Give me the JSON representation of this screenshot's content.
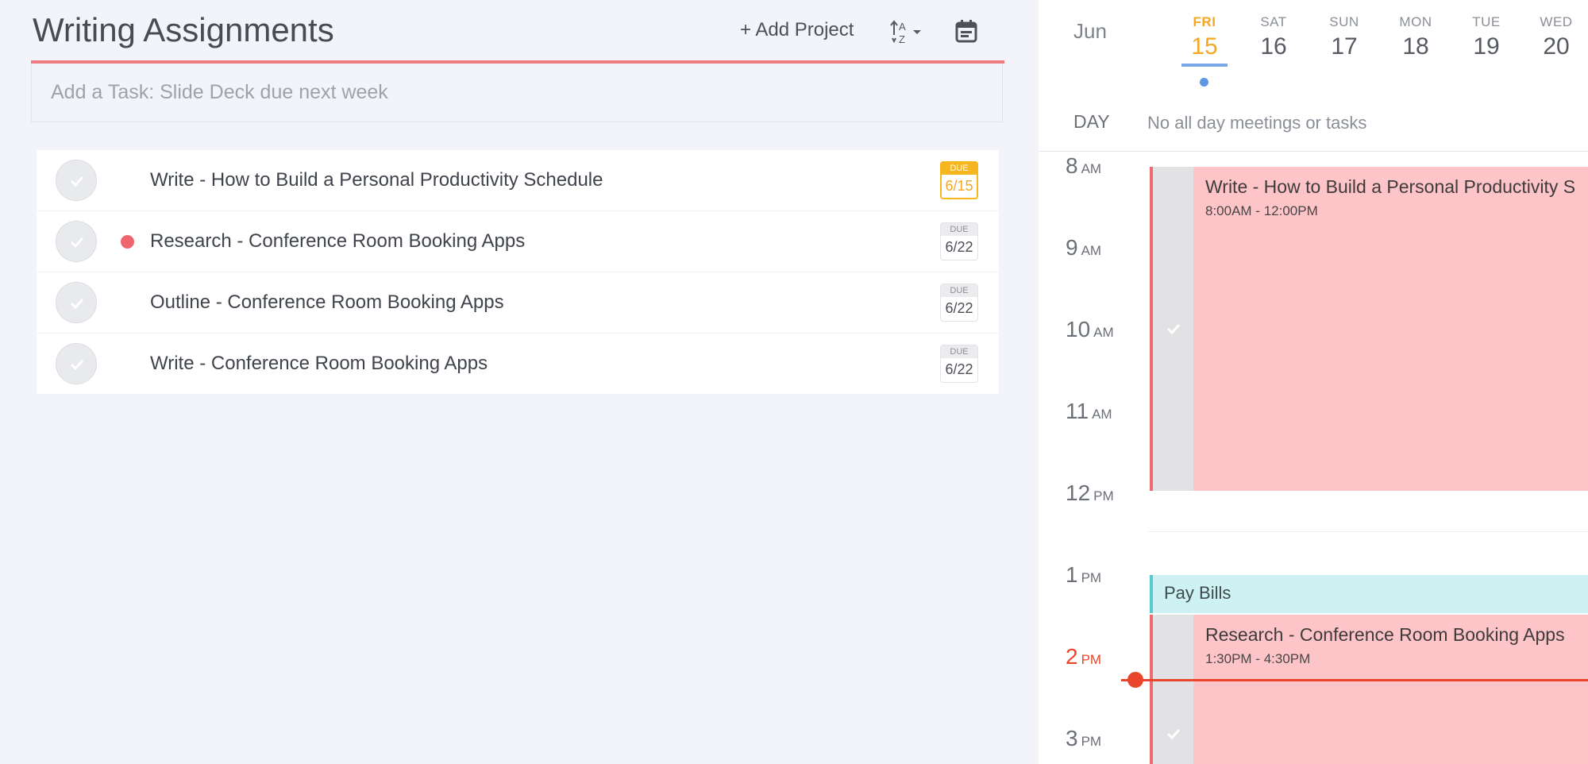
{
  "project": {
    "title": "Writing Assignments",
    "add_project_label": "+ Add Project",
    "sort_label": "A Z",
    "add_task_placeholder": "Add a Task: Slide Deck due next week"
  },
  "tasks": [
    {
      "title": "Write - How to Build a Personal Productivity Schedule",
      "due_label": "DUE",
      "due_date": "6/15",
      "priority": false,
      "today": true
    },
    {
      "title": "Research - Conference Room Booking Apps",
      "due_label": "DUE",
      "due_date": "6/22",
      "priority": true,
      "today": false
    },
    {
      "title": "Outline - Conference Room Booking Apps",
      "due_label": "DUE",
      "due_date": "6/22",
      "priority": false,
      "today": false
    },
    {
      "title": "Write - Conference Room Booking Apps",
      "due_label": "DUE",
      "due_date": "6/22",
      "priority": false,
      "today": false
    }
  ],
  "calendar": {
    "month": "Jun",
    "days": [
      {
        "name": "FRI",
        "num": "15",
        "active": true
      },
      {
        "name": "SAT",
        "num": "16",
        "active": false
      },
      {
        "name": "SUN",
        "num": "17",
        "active": false
      },
      {
        "name": "MON",
        "num": "18",
        "active": false
      },
      {
        "name": "TUE",
        "num": "19",
        "active": false
      },
      {
        "name": "WED",
        "num": "20",
        "active": false
      }
    ],
    "allday_label": "DAY",
    "allday_text": "No all day meetings or tasks",
    "hours": [
      {
        "num": "8",
        "ampm": "AM"
      },
      {
        "num": "9",
        "ampm": "AM"
      },
      {
        "num": "10",
        "ampm": "AM"
      },
      {
        "num": "11",
        "ampm": "AM"
      },
      {
        "num": "12",
        "ampm": "PM"
      },
      {
        "num": "1",
        "ampm": "PM"
      },
      {
        "num": "2",
        "ampm": "PM"
      },
      {
        "num": "3",
        "ampm": "PM"
      }
    ],
    "events": [
      {
        "title": "Write - How to Build a Personal Productivity S",
        "time": "8:00AM - 12:00PM"
      },
      {
        "title": "Pay Bills"
      },
      {
        "title": "Research - Conference Room Booking Apps",
        "time": "1:30PM - 4:30PM"
      }
    ]
  },
  "colors": {
    "accent_red": "#f07c82",
    "today_orange": "#f5a623",
    "now_line": "#e8452b",
    "event_pink": "#fdc5c7",
    "task_cyan": "#cef2f3"
  }
}
